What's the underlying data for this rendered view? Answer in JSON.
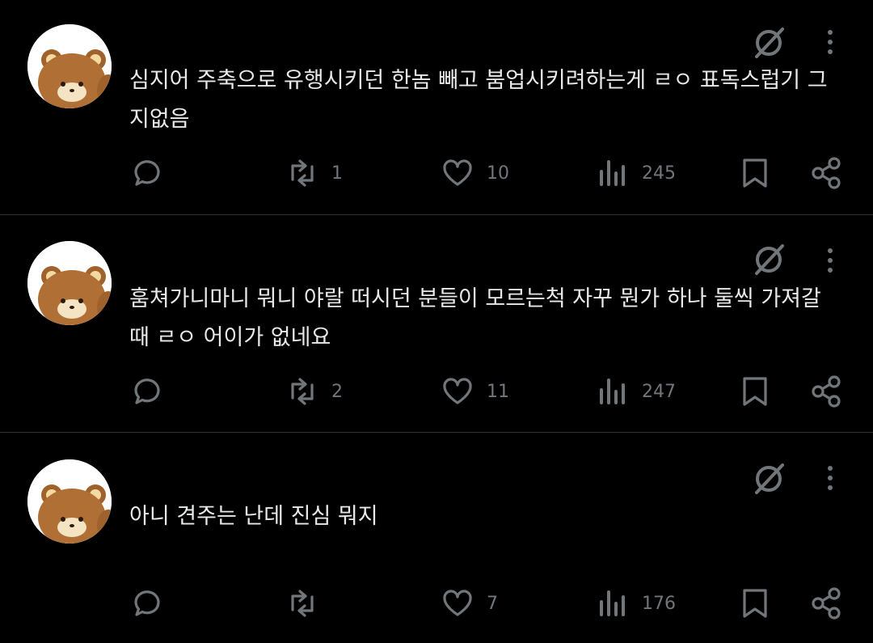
{
  "posts": [
    {
      "text": "심지어 주축으로 유행시키던 한놈 빼고 붐업시키려하는게 ㄹㅇ 표독스럽기 그지없음",
      "retweets": "1",
      "likes": "10",
      "views": "245"
    },
    {
      "text": "훔쳐가니마니 뭐니 야랄 떠시던 분들이 모르는척 자꾸 뭔가 하나 둘씩 가져갈때 ㄹㅇ 어이가 없네요",
      "retweets": "2",
      "likes": "11",
      "views": "247"
    },
    {
      "text": "아니 견주는 난데 진심 뭐지",
      "retweets": "",
      "likes": "7",
      "views": "176"
    }
  ],
  "icons": {
    "grok": "grok-icon",
    "more": "more-vertical-icon",
    "reply": "reply-icon",
    "retweet": "retweet-icon",
    "like": "heart-icon",
    "views": "views-icon",
    "bookmark": "bookmark-icon",
    "share": "share-icon"
  },
  "colors": {
    "background": "#000000",
    "text": "#e7e9ea",
    "muted": "#71767b",
    "divider": "#2f3336"
  }
}
